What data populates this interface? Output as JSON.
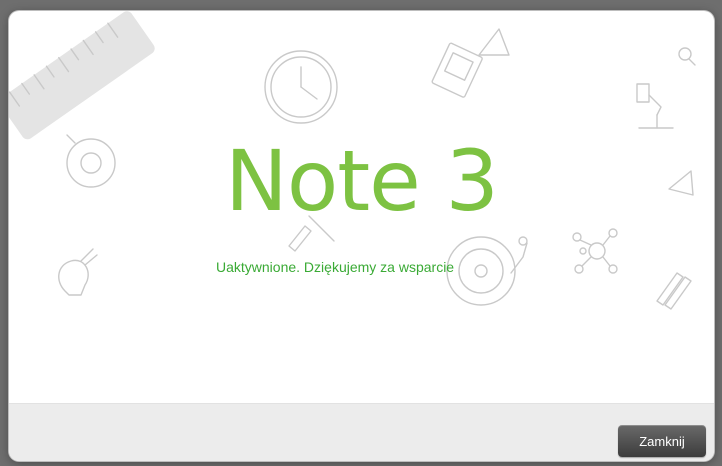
{
  "dialog": {
    "app_title": "Note 3",
    "status_message": "Uaktywnione. Dziękujemy za wsparcie",
    "close_label": "Zamknij"
  },
  "colors": {
    "title_green": "#7dc242",
    "message_green": "#3aaa35",
    "footer_bg": "#ececec",
    "button_dark": "#4a4a4a"
  },
  "background_icons": [
    "ruler-icon",
    "clock-icon",
    "book-icon",
    "triangle-ruler-icon",
    "magnifier-icon",
    "desk-lamp-icon",
    "target-icon",
    "lightbulb-icon",
    "pencil-icon",
    "compass-icon",
    "vinyl-record-icon",
    "network-icon",
    "pencils-icon"
  ]
}
